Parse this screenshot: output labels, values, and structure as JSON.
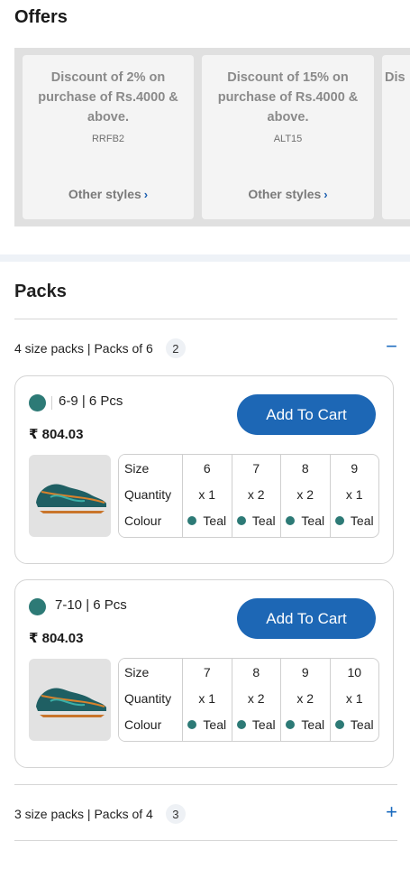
{
  "offers": {
    "title": "Offers",
    "items": [
      {
        "text": "Discount of 2% on purchase of Rs.4000 & above.",
        "code": "RRFB2",
        "link": "Other styles"
      },
      {
        "text": "Discount of 15% on purchase of Rs.4000 & above.",
        "code": "ALT15",
        "link": "Other styles"
      },
      {
        "text": "Dis",
        "code": "",
        "link": ""
      }
    ]
  },
  "packs": {
    "title": "Packs",
    "groups": [
      {
        "label": "4 size packs | Packs of 6",
        "count": "2",
        "toggle": "−",
        "expanded": true
      },
      {
        "label": "3 size packs | Packs of 4",
        "count": "3",
        "toggle": "+",
        "expanded": false
      }
    ],
    "cards": [
      {
        "name": "6-9 | 6 Pcs",
        "price": "₹ 804.03",
        "button": "Add To Cart",
        "row_labels": [
          "Size",
          "Quantity",
          "Colour"
        ],
        "sizes": [
          "6",
          "7",
          "8",
          "9"
        ],
        "quantities": [
          "x 1",
          "x 2",
          "x 2",
          "x 1"
        ],
        "colours": [
          "Teal",
          "Teal",
          "Teal",
          "Teal"
        ]
      },
      {
        "name": "7-10 | 6 Pcs",
        "price": "₹ 804.03",
        "button": "Add To Cart",
        "row_labels": [
          "Size",
          "Quantity",
          "Colour"
        ],
        "sizes": [
          "7",
          "8",
          "9",
          "10"
        ],
        "quantities": [
          "x 1",
          "x 2",
          "x 2",
          "x 1"
        ],
        "colours": [
          "Teal",
          "Teal",
          "Teal",
          "Teal"
        ]
      }
    ]
  },
  "colors": {
    "accent": "#1d67b5",
    "swatch": "#2d7a76"
  },
  "icons": {
    "chevron": "chevron-right-icon",
    "collapse": "minus-icon",
    "expand": "plus-icon"
  }
}
